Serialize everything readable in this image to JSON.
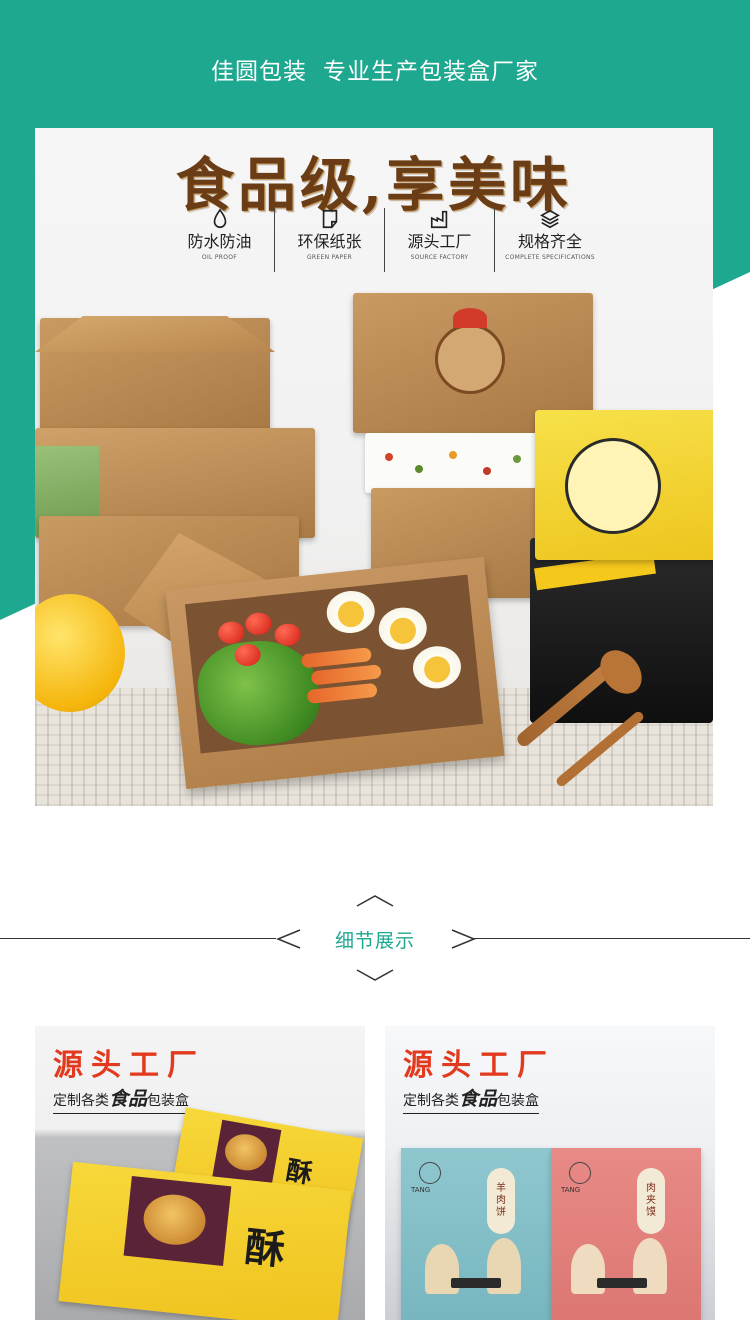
{
  "banner": {
    "brand": "佳圆包装",
    "tagline": "专业生产包装盒厂家"
  },
  "hero": {
    "headline": "食品级,享美味",
    "features": [
      {
        "label": "防水防油",
        "sub": "OIL PROOF",
        "icon": "water-drop-icon"
      },
      {
        "label": "环保纸张",
        "sub": "GREEN PAPER",
        "icon": "paper-sheet-icon"
      },
      {
        "label": "源头工厂",
        "sub": "SOURCE FACTORY",
        "icon": "factory-icon"
      },
      {
        "label": "规格齐全",
        "sub": "COMPLETE SPECIFICATIONS",
        "icon": "layers-icon"
      }
    ]
  },
  "section": {
    "title": "细节展示"
  },
  "details": [
    {
      "title": "源头工厂",
      "sub_prefix": "定制各类",
      "sub_emph": "食品",
      "sub_suffix": "包装盒"
    },
    {
      "title": "源头工厂",
      "sub_prefix": "定制各类",
      "sub_emph": "食品",
      "sub_suffix": "包装盒"
    }
  ],
  "colors": {
    "teal": "#1ea890",
    "kraft": "#b8874f",
    "title_red": "#e23a1e"
  }
}
